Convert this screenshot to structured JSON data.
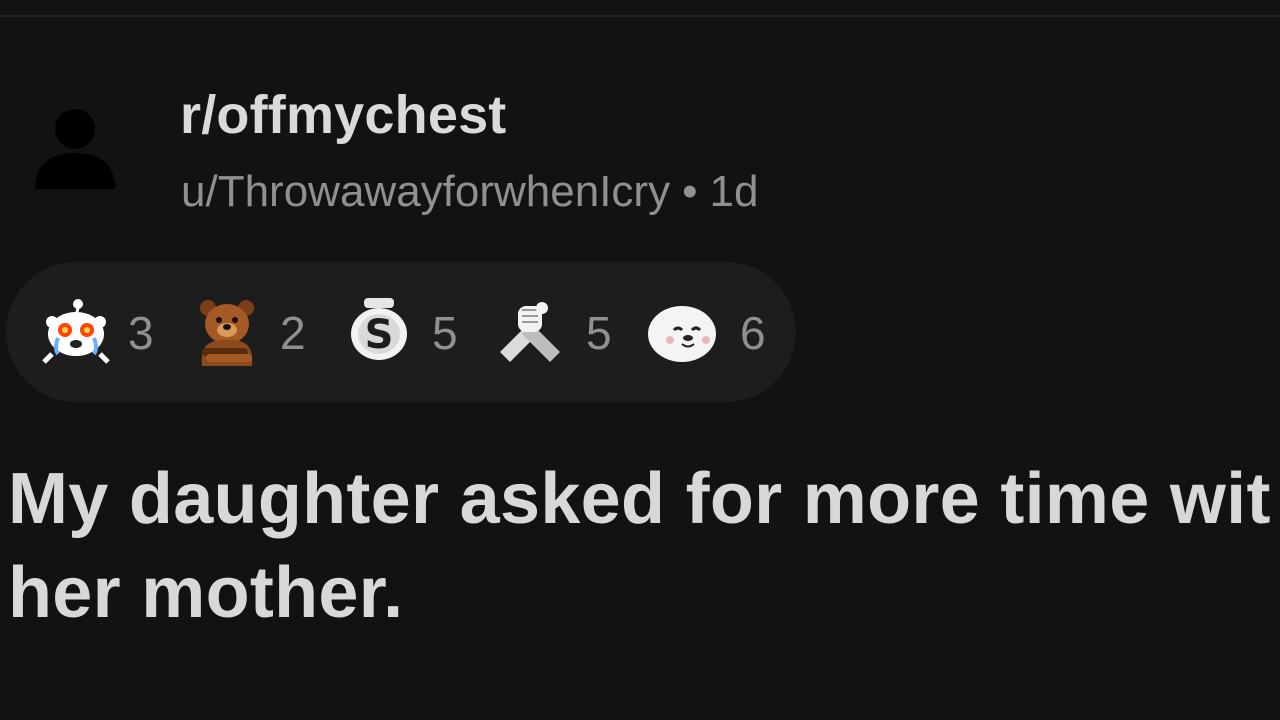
{
  "post": {
    "subreddit": "r/offmychest",
    "author": "u/ThrowawayforwhenIcry",
    "separator": "•",
    "age": "1d",
    "title_line1": "My daughter asked for more time wit",
    "title_line2": "her mother."
  },
  "awards": [
    {
      "icon": "crying-snoo-icon",
      "count": "3"
    },
    {
      "icon": "bear-hug-icon",
      "count": "2"
    },
    {
      "icon": "silver-s-coin-icon",
      "count": "5"
    },
    {
      "icon": "handshake-icon",
      "count": "5"
    },
    {
      "icon": "seal-icon",
      "count": "6"
    }
  ],
  "colors": {
    "background": "#121212",
    "pill": "#1d1d1e",
    "text_primary": "#d9dadb",
    "text_secondary": "#8e9194"
  }
}
